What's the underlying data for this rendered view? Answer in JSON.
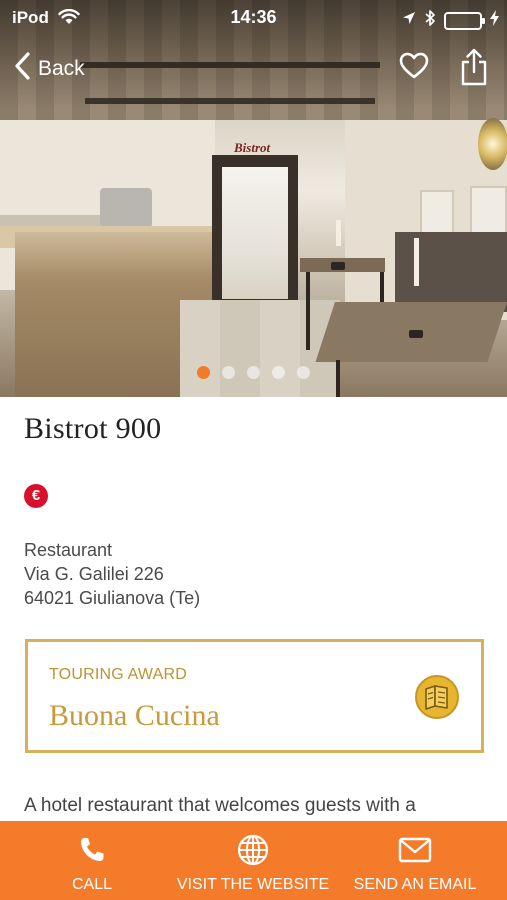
{
  "status_bar": {
    "carrier": "iPod",
    "time": "14:36",
    "wifi_icon": "wifi-icon",
    "location_icon": "location-arrow-icon",
    "bluetooth_icon": "bluetooth-icon",
    "battery_icon": "battery-charging-icon",
    "battery_color": "#4cd964"
  },
  "nav": {
    "back_label": "Back",
    "favorite_icon": "heart-icon",
    "share_icon": "share-icon"
  },
  "gallery": {
    "total_photos": 5,
    "active_index": 0,
    "active_dot_color": "#f07b2b",
    "photo_sign_text": "Bistrot"
  },
  "venue": {
    "name": "Bistrot 900",
    "price_symbol": "€",
    "price_color": "#d8102a",
    "category": "Restaurant",
    "street": "Via G. Galilei 226",
    "city": "64021 Giulianova (Te)"
  },
  "award": {
    "label": "TOURING AWARD",
    "name": "Buona Cucina",
    "icon": "award-book-icon",
    "color": "#d6b15a"
  },
  "description": {
    "preview": "A hotel restaurant that welcomes guests with a"
  },
  "actions": {
    "bar_color": "#f47b2a",
    "call": {
      "label": "CALL",
      "icon": "phone-icon"
    },
    "website": {
      "label": "VISIT THE WEBSITE",
      "icon": "globe-icon"
    },
    "email": {
      "label": "SEND AN EMAIL",
      "icon": "envelope-icon"
    }
  }
}
